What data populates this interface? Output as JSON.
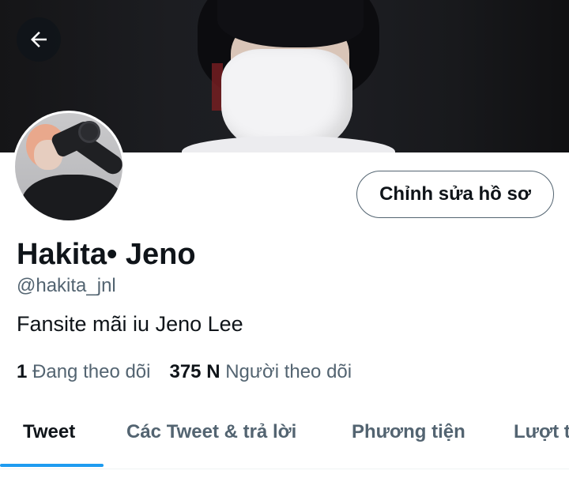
{
  "profile": {
    "display_name": "Hakita• Jeno",
    "handle": "@hakita_jnl",
    "bio": "Fansite mãi iu Jeno Lee",
    "edit_button_label": "Chỉnh sửa hồ sơ"
  },
  "stats": {
    "following_count": "1",
    "following_label": "Đang theo dõi",
    "followers_count": "375 N",
    "followers_label": "Người theo dõi"
  },
  "tabs": [
    {
      "label": "Tweet",
      "active": true
    },
    {
      "label": "Các Tweet & trả lời",
      "active": false
    },
    {
      "label": "Phương tiện",
      "active": false
    },
    {
      "label": "Lượt t",
      "active": false
    }
  ],
  "icons": {
    "back": "arrow-left-icon"
  },
  "colors": {
    "accent": "#1d9bf0",
    "text_primary": "#0f1419",
    "text_secondary": "#536471"
  }
}
